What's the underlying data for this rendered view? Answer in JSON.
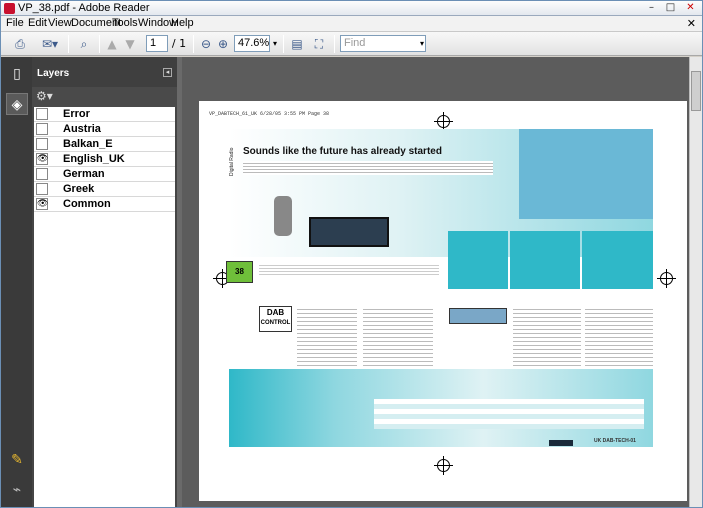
{
  "window": {
    "title": "VP_38.pdf - Adobe Reader"
  },
  "menu": {
    "items": [
      "File",
      "Edit",
      "View",
      "Document",
      "Tools",
      "Window",
      "Help"
    ],
    "close": "✕"
  },
  "toolbar": {
    "page_current": "1",
    "page_total": "/ 1",
    "zoom": "47.6%",
    "find_placeholder": "Find"
  },
  "layers": {
    "title": "Layers",
    "items": [
      {
        "name": "Error",
        "visible": false
      },
      {
        "name": "Austria",
        "visible": false
      },
      {
        "name": "Balkan_E",
        "visible": false
      },
      {
        "name": "English_UK",
        "visible": true
      },
      {
        "name": "German",
        "visible": false
      },
      {
        "name": "Greek",
        "visible": false
      },
      {
        "name": "Common",
        "visible": true
      }
    ]
  },
  "document": {
    "header_line": "VP_DABTECH_61_UK   6/28/05   3:55 PM   Page 38",
    "headline": "Sounds like the future has already started",
    "section_label": "Digital Radio",
    "page_badge": "38",
    "dab_logo_line1": "DAB",
    "dab_logo_line2": "CONTROL",
    "footer_right": "UK    DAB-TECH-01"
  },
  "icons": {
    "print": "printer-icon",
    "email": "email-icon",
    "search": "search-icon"
  }
}
